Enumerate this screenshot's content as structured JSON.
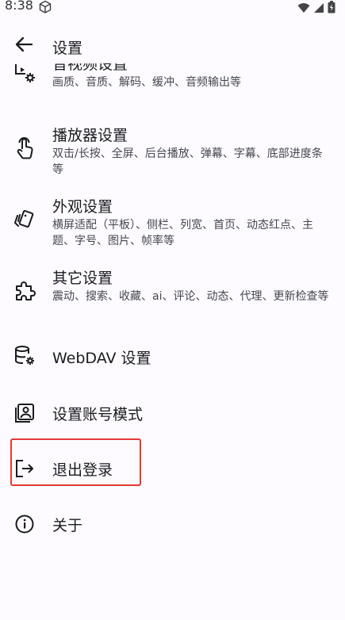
{
  "status_bar": {
    "time": "8:38"
  },
  "app_bar": {
    "title": "设置"
  },
  "items": [
    {
      "title": "音视频设置",
      "subtitle": "画质、音质、解码、缓冲、音频输出等",
      "icon": "video-settings-icon"
    },
    {
      "title": "播放器设置",
      "subtitle": "双击/长按、全屏、后台播放、弹幕、字幕、底部进度条等",
      "icon": "touch-icon"
    },
    {
      "title": "外观设置",
      "subtitle": "横屏适配（平板）、侧栏、列宽、首页、动态红点、主题、字号、图片、帧率等",
      "icon": "style-icon"
    },
    {
      "title": "其它设置",
      "subtitle": "震动、搜索、收藏、ai、评论、动态、代理、更新检查等",
      "icon": "extension-icon"
    },
    {
      "title": "WebDAV 设置",
      "icon": "database-settings-icon"
    },
    {
      "title": "设置账号模式",
      "icon": "account-box-icon"
    },
    {
      "title": "退出登录",
      "icon": "logout-icon"
    },
    {
      "title": "关于",
      "icon": "info-icon"
    }
  ],
  "colors": {
    "highlight": "#e53935",
    "background": "#fdfbff",
    "text": "#1b1b1f",
    "subtext": "#45464f"
  }
}
